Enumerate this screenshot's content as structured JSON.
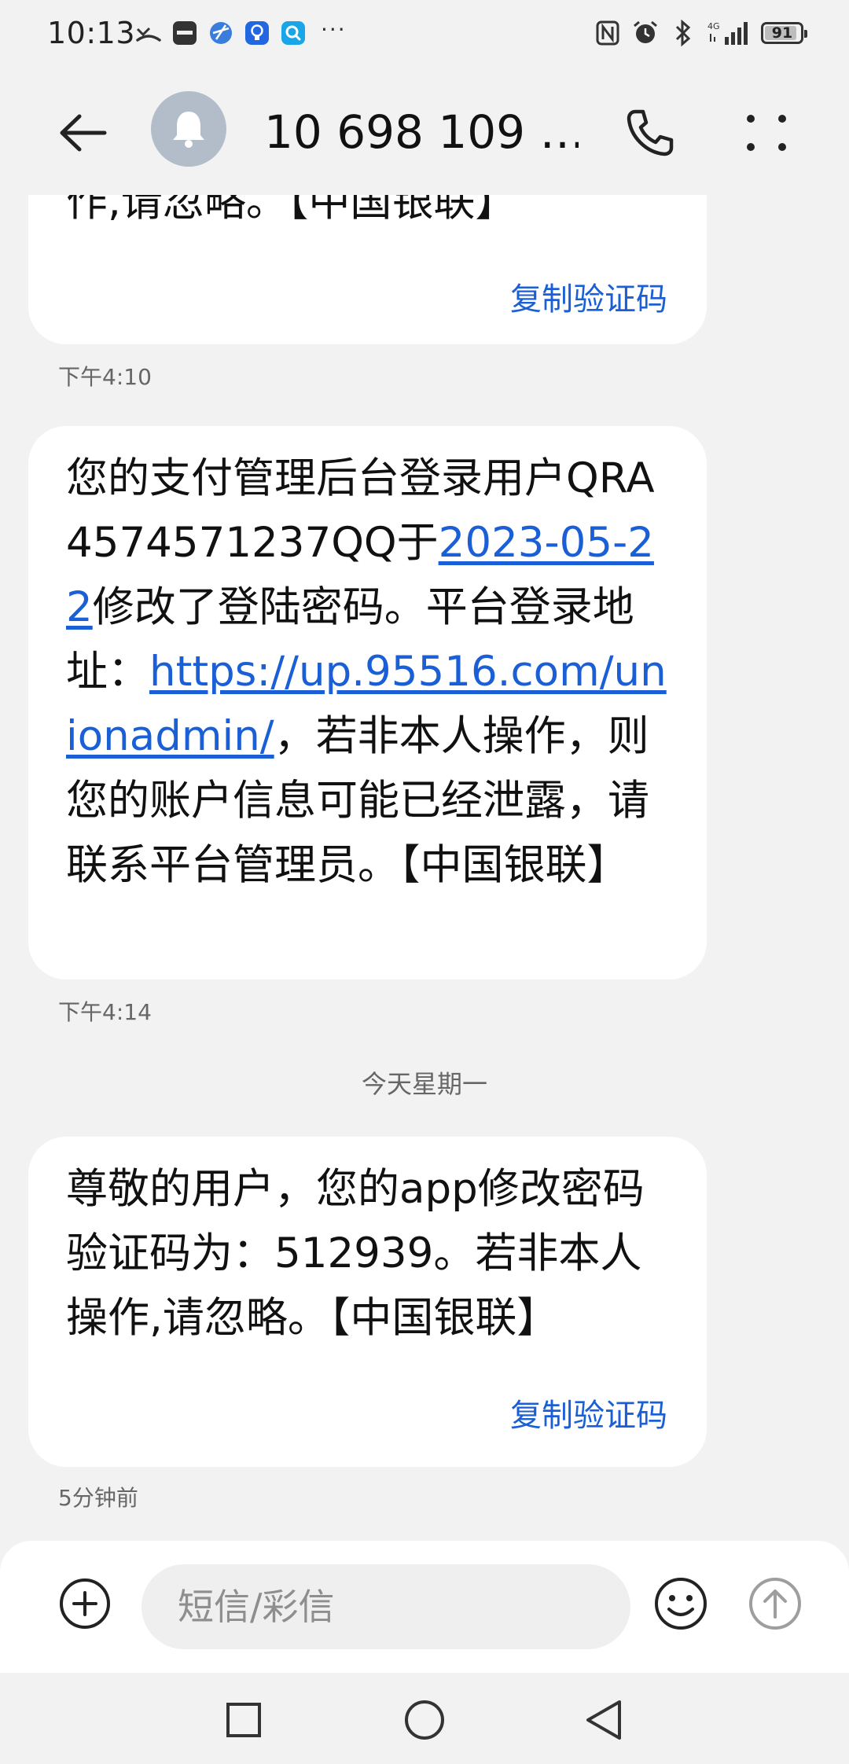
{
  "status_bar": {
    "time": "10:13",
    "left_icons": [
      "missed-call-icon",
      "huawei-app-icon",
      "browser-icon",
      "lightbulb-app-icon",
      "search-app-icon"
    ],
    "more": "···",
    "right_icons": [
      "nfc-icon",
      "alarm-icon",
      "bluetooth-icon",
      "4g-signal-icon"
    ],
    "network": "4G",
    "battery_level": "91"
  },
  "header": {
    "contact_name": "10 698 109 …",
    "avatar_icon": "bell-icon"
  },
  "messages": [
    {
      "text_partial": "作,请忽略。【中国银联】",
      "copy_label": "复制验证码",
      "time": "下午4:10"
    },
    {
      "segments": [
        {
          "text": "您的支付管理后台登录用户QRA4574571237QQ于",
          "link": false
        },
        {
          "text": "2023-05-22",
          "link": true
        },
        {
          "text": "修改了登陆密码。平台登录地址：",
          "link": false
        },
        {
          "text": "https://up.95516.com/unionadmin/",
          "link": true
        },
        {
          "text": "，若非本人操作，则您的账户信息可能已经泄露，请联系平台管理员。【中国银联】",
          "link": false
        }
      ],
      "time": "下午4:14"
    },
    {
      "divider": "今天星期一"
    },
    {
      "text": "尊敬的用户，您的app修改密码验证码为：512939。若非本人操作,请忽略。【中国银联】",
      "copy_label": "复制验证码",
      "time": "5分钟前"
    }
  ],
  "composer": {
    "placeholder": "短信/彩信",
    "value": ""
  },
  "colors": {
    "link": "#1a5fd6",
    "bubble": "#ffffff",
    "background": "#f2f2f2",
    "avatar": "#b3bdc9"
  }
}
